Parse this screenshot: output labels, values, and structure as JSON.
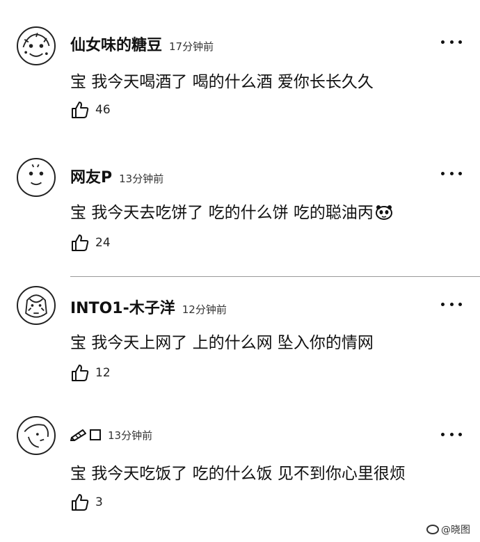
{
  "comments": [
    {
      "username": "仙女味的糖豆",
      "timestamp": "17分钟前",
      "text": "宝 我今天喝酒了 喝的什么酒 爱你长长久久",
      "likes": "46",
      "avatar_icon": "avatar-cartoon-icon"
    },
    {
      "username": "网友P",
      "timestamp": "13分钟前",
      "text": "宝 我今天去吃饼了 吃的什么饼 吃的聪油丙",
      "likes": "24",
      "avatar_icon": "avatar-face-icon",
      "trailing_emoji": "panda-emoji-icon"
    },
    {
      "username": "INTO1-木子洋",
      "timestamp": "12分钟前",
      "text": "宝 我今天上网了 上的什么网 坠入你的情网",
      "likes": "12",
      "avatar_icon": "avatar-photo-icon"
    },
    {
      "username": "",
      "username_icons": [
        "pencil-icon",
        "square-icon"
      ],
      "timestamp": "13分钟前",
      "text": "宝 我今天吃饭了 吃的什么饭 见不到你心里很烦",
      "likes": "3",
      "avatar_icon": "avatar-sketch-icon"
    }
  ],
  "watermark": {
    "text": "@晓图",
    "icon": "weibo-logo-icon"
  },
  "colors": {
    "background": "#ffffff",
    "text": "#111111",
    "divider": "#999999"
  }
}
